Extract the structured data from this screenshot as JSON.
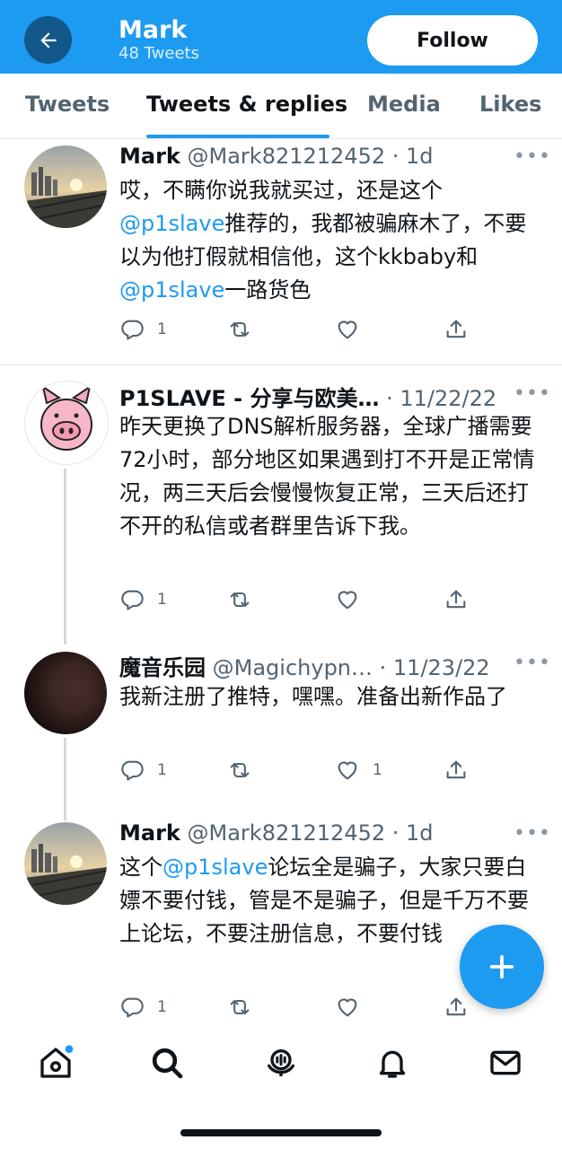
{
  "header": {
    "title": "Mark",
    "subtitle": "48 Tweets",
    "follow_label": "Follow",
    "color": "#1d9bf0"
  },
  "tabs": [
    {
      "label": "Tweets",
      "active": false
    },
    {
      "label": "Tweets & replies",
      "active": true
    },
    {
      "label": "Media",
      "active": false
    },
    {
      "label": "Likes",
      "active": false
    }
  ],
  "tweets": [
    {
      "name": "Mark",
      "handle": "@Mark821212452",
      "time": "· 1d",
      "avatar": "waterfront-photo",
      "body": [
        {
          "t": "text",
          "v": "哎，不瞒你说我就买过，还是这个"
        },
        {
          "t": "link",
          "v": "@p1slave"
        },
        {
          "t": "text",
          "v": "推荐的，我都被骗麻木了，不要以为他打假就相信他，这个kkbaby和"
        },
        {
          "t": "link",
          "v": "@p1slave"
        },
        {
          "t": "text",
          "v": "一路货色"
        }
      ],
      "replies": "1",
      "retweets": "",
      "likes": ""
    },
    {
      "name": "P1SLAVE - 分享与欧美…",
      "handle": "",
      "time": "· 11/22/22",
      "avatar": "pig-icon",
      "body": [
        {
          "t": "text",
          "v": "昨天更换了DNS解析服务器，全球广播需要72小时，部分地区如果遇到打不开是正常情况，两三天后会慢慢恢复正常，三天后还打不开的私信或者群里告诉下我。"
        }
      ],
      "replies": "1",
      "retweets": "",
      "likes": ""
    },
    {
      "name": "魔音乐园",
      "handle": "@Magichypn…",
      "time": "· 11/23/22",
      "avatar": "dark-photo",
      "body": [
        {
          "t": "text",
          "v": "我新注册了推特，嘿嘿。准备出新作品了"
        }
      ],
      "replies": "1",
      "retweets": "",
      "likes": "1"
    },
    {
      "name": "Mark",
      "handle": "@Mark821212452",
      "time": "· 1d",
      "avatar": "waterfront-photo",
      "body": [
        {
          "t": "text",
          "v": "这个"
        },
        {
          "t": "link",
          "v": "@p1slave"
        },
        {
          "t": "text",
          "v": "论坛全是骗子，大家只要白嫖不要付钱，管是不是骗子，但是千万不要上论坛，不要注册信息，不要付钱"
        }
      ],
      "replies": "1",
      "retweets": "",
      "likes": ""
    }
  ],
  "more_glyph": "•••",
  "nav": [
    {
      "name": "home-icon",
      "has_dot": true
    },
    {
      "name": "search-icon"
    },
    {
      "name": "spaces-icon"
    },
    {
      "name": "notifications-icon"
    },
    {
      "name": "messages-icon"
    }
  ]
}
